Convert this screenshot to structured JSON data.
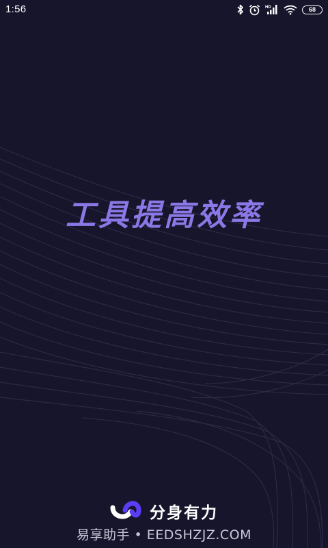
{
  "status_bar": {
    "time": "1:56",
    "battery": "68",
    "network_badge": "HD",
    "icons": [
      "bluetooth-icon",
      "alarm-icon",
      "signal-icon",
      "wifi-icon",
      "battery-icon"
    ]
  },
  "splash": {
    "slogan": "工具提高效率",
    "slogan_color": "#8b78e6",
    "background_color": "#17152b"
  },
  "brand": {
    "name": "分身有力",
    "logo": "app-logo-icon",
    "logo_colors": [
      "#ffffff",
      "#5b3df5"
    ]
  },
  "watermark": {
    "text": "易享助手 • EEDSHZJZ.COM"
  }
}
